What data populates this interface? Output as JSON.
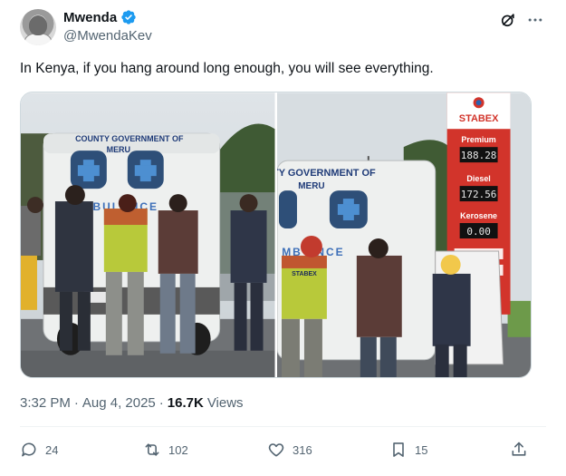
{
  "author": {
    "display_name": "Mwenda",
    "handle": "@MwendaKev",
    "verified": true,
    "avatar_icon": "profile-photo"
  },
  "tweet": {
    "text": "In Kenya, if you hang around long enough, you will see everything."
  },
  "media": {
    "photo1": {
      "ambulance_line1": "COUNTY GOVERNMENT OF",
      "ambulance_line2": "MERU",
      "ambulance_side": "MBULANCE"
    },
    "photo2": {
      "ambulance_line1": "NTY GOVERNMENT OF",
      "ambulance_line2": "MERU",
      "ambulance_side": "MB     ANCE",
      "station_brand": "STABEX",
      "premium_label": "Premium",
      "premium_price": "188.28",
      "diesel_label": "Diesel",
      "diesel_price": "172.56",
      "kerosene_label": "Kerosene",
      "kerosene_price": "0.00",
      "vest_text": "STABEX"
    }
  },
  "meta": {
    "time": "3:32 PM",
    "separator": "·",
    "date": "Aug 4, 2025",
    "views_count": "16.7K",
    "views_label": "Views"
  },
  "actions": {
    "replies": "24",
    "reposts": "102",
    "likes": "316",
    "bookmarks": "15"
  },
  "colors": {
    "verified_blue": "#1d9bf0",
    "secondary_text": "#536471",
    "primary_text": "#0f1419"
  },
  "icons": [
    "grok-icon",
    "more-icon",
    "reply-icon",
    "repost-icon",
    "like-icon",
    "bookmark-icon",
    "share-icon",
    "verified-badge-icon"
  ]
}
